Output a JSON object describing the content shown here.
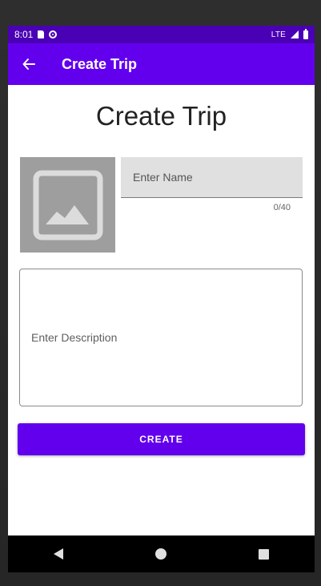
{
  "status_bar": {
    "time": "8:01",
    "network": "LTE",
    "icons": [
      "sd-card-icon",
      "sync-icon",
      "signal-icon",
      "battery-icon"
    ]
  },
  "app_bar": {
    "title": "Create Trip",
    "back_icon": "arrow-back-icon"
  },
  "main": {
    "heading": "Create Trip",
    "image_placeholder_icon": "image-icon",
    "name_field": {
      "placeholder": "Enter Name",
      "counter": "0/40"
    },
    "description_field": {
      "placeholder": "Enter Description"
    },
    "create_button_label": "CREATE"
  },
  "nav_bar": {
    "icons": [
      "nav-back-icon",
      "nav-home-icon",
      "nav-recents-icon"
    ]
  },
  "colors": {
    "primary": "#6200ee",
    "status_bar": "#4a00b4"
  }
}
